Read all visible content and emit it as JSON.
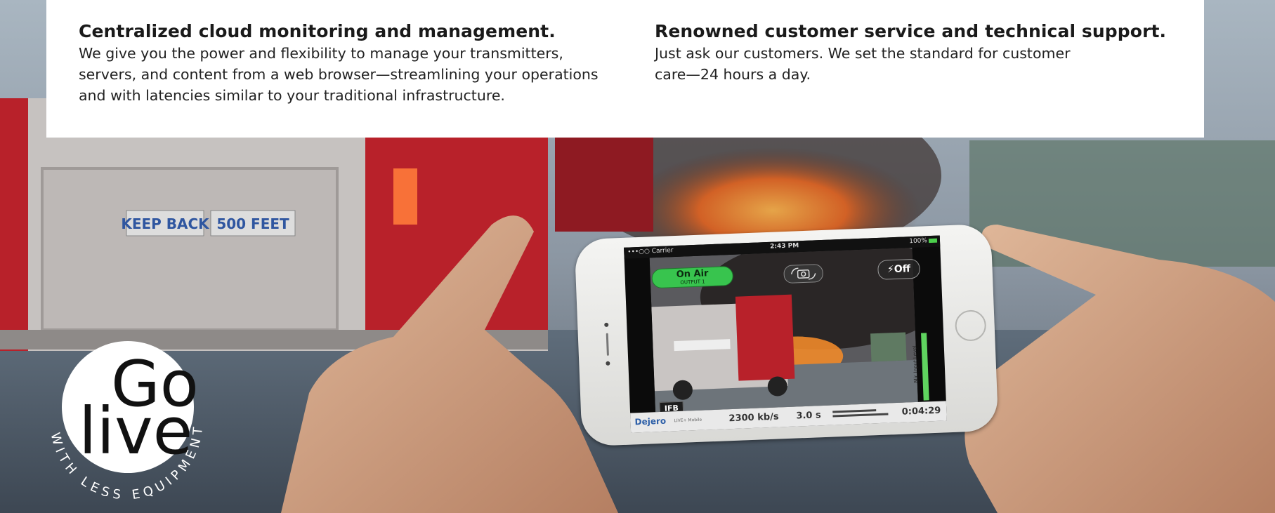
{
  "features": [
    {
      "heading": "Centralized cloud monitoring and management.",
      "body": "We give you the power and flexibility to manage your transmitters, servers, and content from a web browser—streamlining your operations and with latencies similar to your traditional infrastructure."
    },
    {
      "heading": "Renowned customer service and technical support.",
      "body": "Just ask our customers. We set the standard for customer care—24 hours a day."
    }
  ],
  "scene": {
    "truck_sign_left": "KEEP BACK",
    "truck_sign_right": "500 FEET"
  },
  "phone": {
    "status": {
      "carrier": "•••○○ Carrier",
      "time": "2:43 PM",
      "battery": "100%"
    },
    "on_air_label": "On Air",
    "on_air_sub": "OUTPUT 1",
    "flash_label": "⚡Off",
    "ifb_label": "IFB",
    "level_label": "Mic Input Level",
    "brand": "Dejero",
    "product": "LIVE+ Mobile",
    "bitrate": "2300 kb/s",
    "latency": "3.0 s",
    "elapsed": "0:04:29"
  },
  "badge": {
    "go": "Go",
    "live": "live",
    "tagline": "WITH LESS EQUIPMENT"
  },
  "colors": {
    "panel": "#ffffff",
    "on_air_green": "#38c44e",
    "brand_blue": "#2d5fa8",
    "fire_orange": "#e8641e"
  }
}
